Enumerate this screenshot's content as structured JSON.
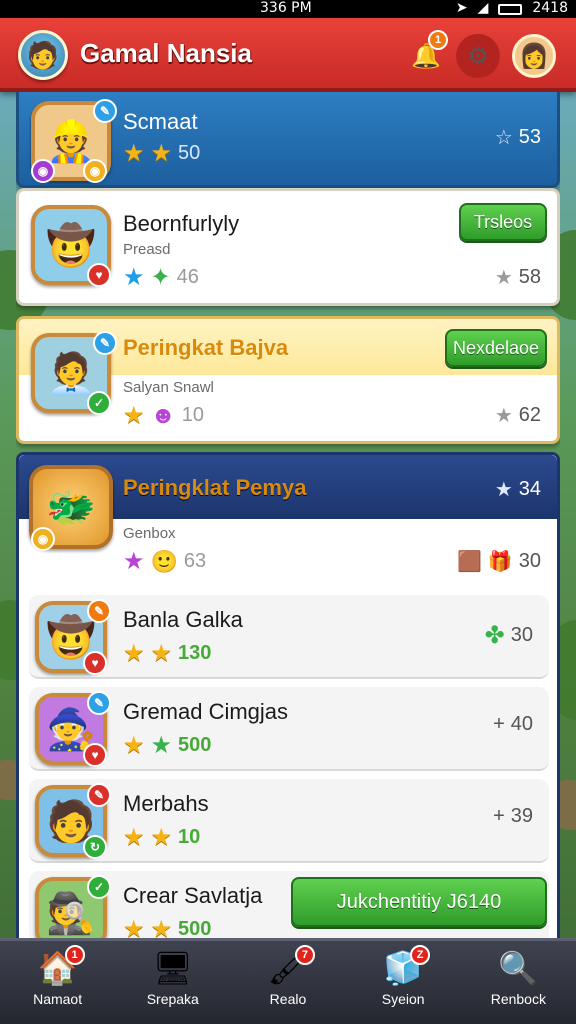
{
  "status_bar": {
    "time": "336 PM",
    "right_time": "2418"
  },
  "header": {
    "title": "Gamal Nansia",
    "notify_badge": "1"
  },
  "cards": [
    {
      "name": "Scmaat",
      "score": "50",
      "right_value": "53"
    },
    {
      "name": "Beornfurlyly",
      "sub": "Preasd",
      "score": "46",
      "right_value": "58",
      "button": "Trsleos"
    },
    {
      "name": "Peringkat Bajva",
      "sub": "Salyan Snawl",
      "score": "10",
      "right_value": "62",
      "button": "Nexdelaoe"
    },
    {
      "name": "Peringklat Pemya",
      "right_value": "34",
      "sub": "Genbox",
      "score": "63",
      "right_value_2": "30"
    }
  ],
  "rows": [
    {
      "name": "Banla Galka",
      "score": "130",
      "right_value": "30"
    },
    {
      "name": "Gremad Cimgjas",
      "score": "500",
      "right_value": "40"
    },
    {
      "name": "Merbahs",
      "score": "10",
      "right_value": "39"
    },
    {
      "name": "Crear Savlatja",
      "score": "500",
      "button": "Jukchentitiy J6140"
    }
  ],
  "bottom_nav": [
    {
      "label": "Namaot",
      "icon": "home-icon",
      "badge": "1"
    },
    {
      "label": "Srepaka",
      "icon": "computer-icon",
      "badge": ""
    },
    {
      "label": "Realo",
      "icon": "brush-icon",
      "badge": "7"
    },
    {
      "label": "Syeion",
      "icon": "cube-icon",
      "badge": "Z"
    },
    {
      "label": "Renbock",
      "icon": "magnifier-icon",
      "badge": ""
    }
  ]
}
